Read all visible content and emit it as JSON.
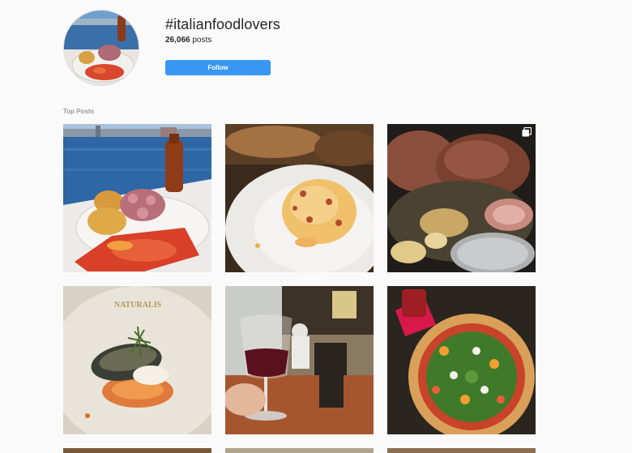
{
  "header": {
    "hashtag": "#italianfoodlovers",
    "post_count": "26,066",
    "post_count_suffix": " posts",
    "follow_label": "Follow"
  },
  "sections": {
    "top_posts_label": "Top Posts"
  },
  "posts": [
    {
      "name": "post-seafront-octopus-dish",
      "icon": "none"
    },
    {
      "name": "post-pasta-carbonara",
      "icon": "none"
    },
    {
      "name": "post-steak-onions-pan",
      "icon": "carousel-icon"
    },
    {
      "name": "post-naturalis-eggplant-dish",
      "icon": "none"
    },
    {
      "name": "post-restaurant-wine-glass",
      "icon": "none"
    },
    {
      "name": "post-arugula-pizza",
      "icon": "none"
    }
  ],
  "plate_text": "NATURALIS",
  "colors": {
    "accent": "#3897f0",
    "background": "#fafafa",
    "label_gray": "#999999"
  }
}
